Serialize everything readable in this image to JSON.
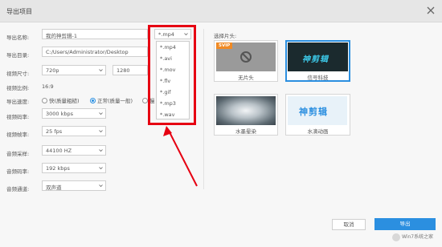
{
  "window": {
    "title": "导出项目"
  },
  "form": {
    "name_label": "导出名称:",
    "name_value": "我的神剪辑-1",
    "format_value": "*.mp4",
    "dir_label": "导出目录:",
    "dir_value": "C:/Users/Administrator/Desktop",
    "size_label": "视频尺寸:",
    "size_value": "720p",
    "width_value": "1280",
    "ratio_label": "视频比例:",
    "ratio_value": "16:9",
    "speed_label": "导出速度:",
    "speed_options": [
      "快(质量粗糙)",
      "正常(质量一般)",
      "慢"
    ],
    "bitrate_label": "视频码率:",
    "bitrate_value": "3000 kbps",
    "fps_label": "视频帧率:",
    "fps_value": "25 fps",
    "samplerate_label": "音频采样:",
    "samplerate_value": "44100 HZ",
    "audiobitrate_label": "音频码率:",
    "audiobitrate_value": "192 kbps",
    "channel_label": "音频通道:",
    "channel_value": "双声道"
  },
  "format_dropdown": {
    "options": [
      "*.mp4",
      "*.avi",
      "*.mov",
      "*.flv",
      "*.gif",
      "*.mp3",
      "*.wav"
    ]
  },
  "intro": {
    "section_label": "选择片头:",
    "items": [
      {
        "label": "无片头",
        "badge": "SVIP"
      },
      {
        "label": "信号科技",
        "logo_text": "神剪辑"
      },
      {
        "label": "水墨晕染"
      },
      {
        "label": "水滴动画",
        "logo_text": "神剪辑"
      }
    ]
  },
  "buttons": {
    "cancel": "取消",
    "export": "导出"
  },
  "watermark": {
    "text": "Win7系统之家"
  },
  "colors": {
    "accent": "#2b8fe0",
    "annotation": "#e60012",
    "badge": "#f08a24"
  }
}
